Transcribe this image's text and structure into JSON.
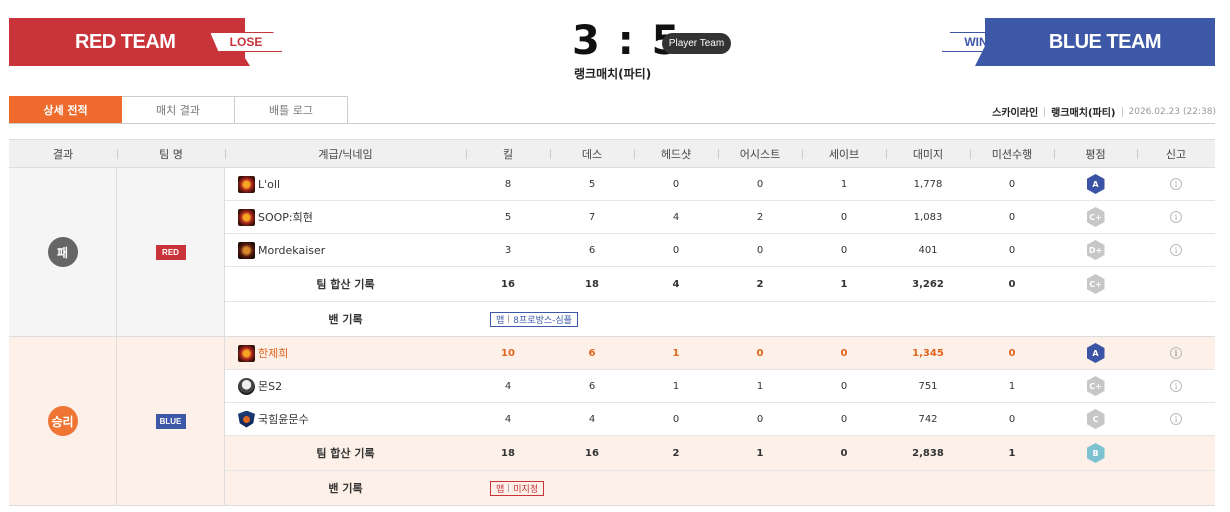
{
  "header": {
    "red_team": "RED TEAM",
    "red_result": "LOSE",
    "blue_team": "BLUE TEAM",
    "blue_result": "WIN",
    "score": "3 : 5",
    "player_team": "Player Team",
    "match_type": "랭크매치(파티)"
  },
  "tabs": [
    "상세 전적",
    "매치 결과",
    "배틀 로그"
  ],
  "meta": {
    "map": "스카이라인",
    "mode": "랭크매치(파티)",
    "date": "2026.02.23",
    "time": "(22:38)"
  },
  "columns": [
    "결과",
    "팀 명",
    "계급/닉네임",
    "킬",
    "데스",
    "헤드샷",
    "어시스트",
    "세이브",
    "대미지",
    "미션수행",
    "평점",
    "신고"
  ],
  "colors": {
    "red": "#c8343a",
    "blue": "#3e58a8",
    "accent": "#ee6a2d"
  },
  "teams": [
    {
      "result": "패",
      "tag": "RED",
      "players": [
        {
          "icon": "rank-fire-icon",
          "nick": "L'oll",
          "kill": "8",
          "death": "5",
          "hs": "0",
          "assist": "0",
          "save": "1",
          "damage": "1,778",
          "mission": "0",
          "grade": "A",
          "grade_color": "navy"
        },
        {
          "icon": "rank-fire-icon",
          "nick": "SOOP:희현",
          "kill": "5",
          "death": "7",
          "hs": "4",
          "assist": "2",
          "save": "0",
          "damage": "1,083",
          "mission": "0",
          "grade": "C+",
          "grade_color": "grey"
        },
        {
          "icon": "rank-dark-icon",
          "nick": "Mordekaiser",
          "kill": "3",
          "death": "6",
          "hs": "0",
          "assist": "0",
          "save": "0",
          "damage": "401",
          "mission": "0",
          "grade": "D+",
          "grade_color": "grey"
        }
      ],
      "total": {
        "label": "팀 합산 기록",
        "kill": "16",
        "death": "18",
        "hs": "4",
        "assist": "2",
        "save": "1",
        "damage": "3,262",
        "mission": "0",
        "grade": "C+"
      },
      "ban": {
        "label": "밴 기록",
        "tag": "맵",
        "value": "8프로방스-심플"
      }
    },
    {
      "result": "승리",
      "tag": "BLUE",
      "players": [
        {
          "icon": "rank-fire-icon",
          "nick": "한제희",
          "kill": "10",
          "death": "6",
          "hs": "1",
          "assist": "0",
          "save": "0",
          "damage": "1,345",
          "mission": "0",
          "grade": "A",
          "grade_color": "navy"
        },
        {
          "icon": "rank-skull-icon",
          "nick": "몬S2",
          "kill": "4",
          "death": "6",
          "hs": "1",
          "assist": "1",
          "save": "0",
          "damage": "751",
          "mission": "1",
          "grade": "C+",
          "grade_color": "grey"
        },
        {
          "icon": "rank-shield-icon",
          "nick": "국힘윤문수",
          "kill": "4",
          "death": "4",
          "hs": "0",
          "assist": "0",
          "save": "0",
          "damage": "742",
          "mission": "0",
          "grade": "C",
          "grade_color": "grey"
        }
      ],
      "total": {
        "label": "팀 합산 기록",
        "kill": "18",
        "death": "16",
        "hs": "2",
        "assist": "1",
        "save": "0",
        "damage": "2,838",
        "mission": "1",
        "grade": "B"
      },
      "ban": {
        "label": "밴 기록",
        "tag": "맵",
        "value": "미지정"
      }
    }
  ]
}
